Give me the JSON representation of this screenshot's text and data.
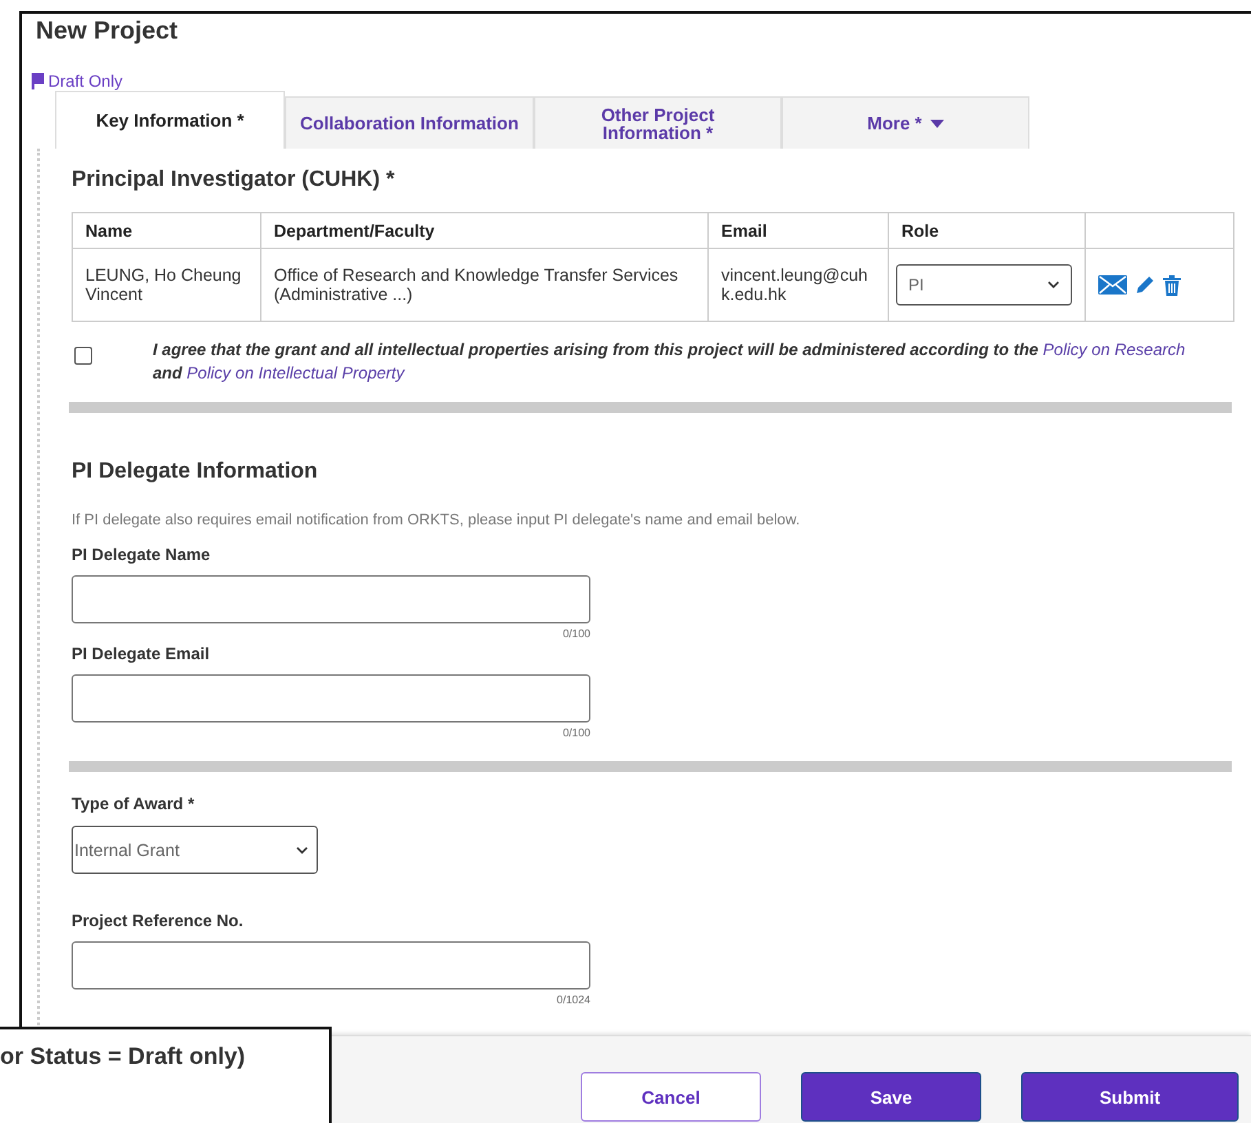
{
  "title": "New Project",
  "draft_label": "Draft Only",
  "tabs": [
    {
      "label": "Key Information *",
      "selected": true,
      "kind": "tab"
    },
    {
      "label": "Collaboration Information",
      "selected": false,
      "kind": "tab"
    },
    {
      "label": "Other Project Information *",
      "selected": false,
      "kind": "tab"
    },
    {
      "label": "More *",
      "selected": false,
      "kind": "dropdown"
    }
  ],
  "pi_section": {
    "heading": "Principal Investigator (CUHK) *",
    "columns": [
      "Name",
      "Department/Faculty",
      "Email",
      "Role"
    ],
    "rows": [
      {
        "name": "LEUNG, Ho Cheung Vincent",
        "department": "Office of Research and Knowledge Transfer Services (Administrative ...)",
        "email": "vincent.leung@cuhk.edu.hk",
        "role": "PI"
      }
    ],
    "agreement": {
      "checked": false,
      "parts": [
        {
          "kind": "text",
          "text": "I agree that the grant and all intellectual properties arising from this project will be administered according to the "
        },
        {
          "kind": "link",
          "text": "Policy on Research"
        },
        {
          "kind": "text",
          "text": " and "
        },
        {
          "kind": "link",
          "text": "Policy on Intellectual Property"
        }
      ]
    }
  },
  "delegate_section": {
    "heading": "PI Delegate Information",
    "note": "If PI delegate also requires email notification from ORKTS, please input PI delegate's name and email below.",
    "fields": [
      {
        "label": "PI Delegate Name",
        "counter": "0/100"
      },
      {
        "label": "PI Delegate Email",
        "counter": "0/100"
      }
    ]
  },
  "award": {
    "label": "Type of Award *",
    "value": "Internal Grant"
  },
  "reference": {
    "label": "Project Reference No.",
    "counter": "0/1024"
  },
  "buttons": [
    {
      "label": "Cancel",
      "kind": "outline"
    },
    {
      "label": "Save",
      "kind": "primary"
    },
    {
      "label": "Submit",
      "kind": "primary"
    }
  ],
  "callout": "or Status = Draft only)"
}
